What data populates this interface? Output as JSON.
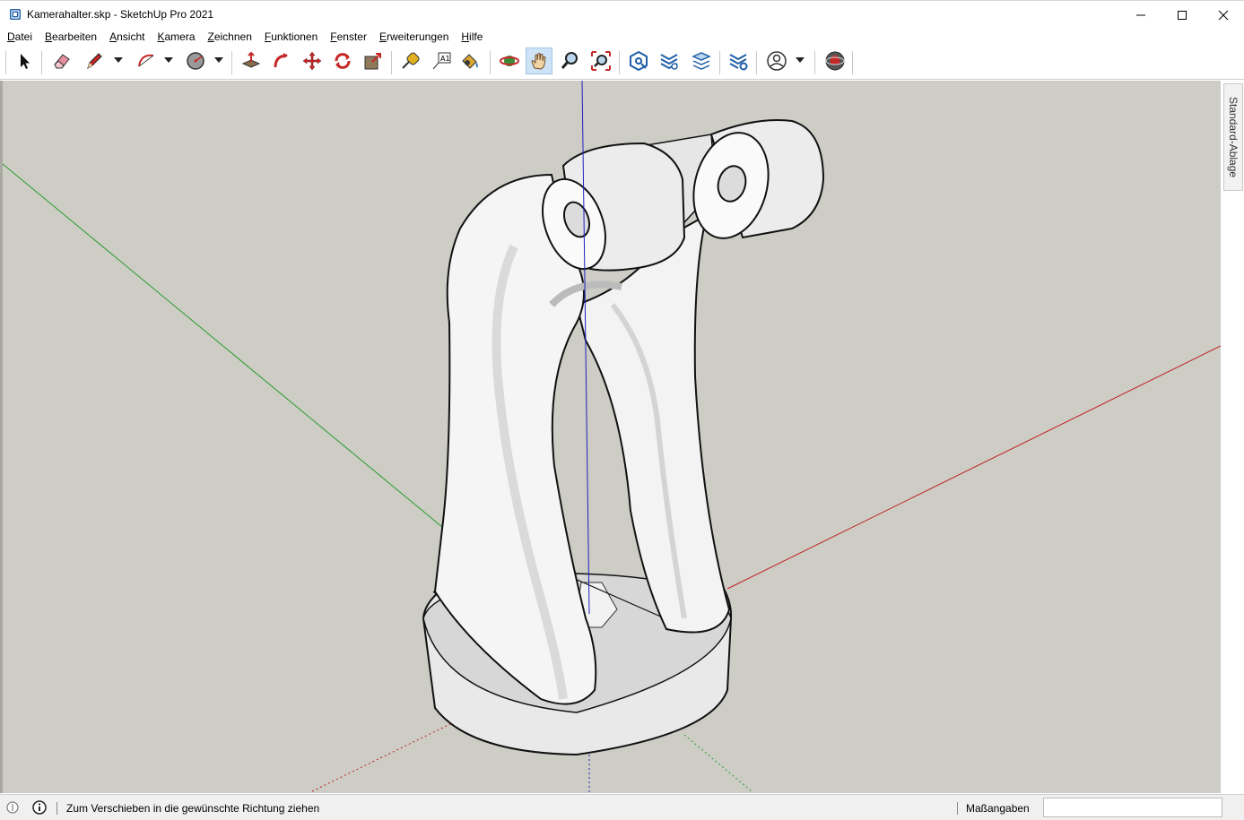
{
  "window": {
    "title": "Kamerahalter.skp - SketchUp Pro 2021"
  },
  "menu": [
    {
      "label": "Datei",
      "accel": "D",
      "rest": "atei"
    },
    {
      "label": "Bearbeiten",
      "accel": "B",
      "rest": "earbeiten"
    },
    {
      "label": "Ansicht",
      "accel": "A",
      "rest": "nsicht"
    },
    {
      "label": "Kamera",
      "accel": "K",
      "rest": "amera"
    },
    {
      "label": "Zeichnen",
      "accel": "Z",
      "pre": "",
      "rest": "eichnen"
    },
    {
      "label": "Funktionen",
      "accel": "F",
      "rest": "unktionen"
    },
    {
      "label": "Fenster",
      "accel": "F",
      "rest": "enster"
    },
    {
      "label": "Erweiterungen",
      "accel": "E",
      "rest": "rweiterungen"
    },
    {
      "label": "Hilfe",
      "accel": "H",
      "rest": "ilfe"
    }
  ],
  "toolbar": {
    "tools": [
      "select-icon",
      "eraser-icon",
      "pencil-icon",
      "arc-icon",
      "circle-icon",
      "push-pull-icon",
      "follow-me-icon",
      "move-icon",
      "rotate-icon",
      "scale-icon",
      "tape-measure-icon",
      "text-icon",
      "paint-bucket-icon",
      "orbit-icon",
      "pan-icon",
      "zoom-icon",
      "zoom-extents-icon",
      "warehouse-icon",
      "extension-warehouse-icon",
      "layers-icon",
      "extension-manager-icon",
      "account-icon",
      "globe-icon"
    ],
    "active_tool": "pan-icon"
  },
  "tray": {
    "tab_label": "Standard-Ablage"
  },
  "status": {
    "hint": "Zum Verschieben in die gewünschte Richtung ziehen",
    "measurements_label": "Maßangaben",
    "measurements_value": ""
  },
  "colors": {
    "viewport_bg": "#cdcdc6",
    "axis_red": "#c02020",
    "axis_green": "#20a020",
    "axis_blue": "#2020c0",
    "model_face": "#f4f4f4"
  }
}
